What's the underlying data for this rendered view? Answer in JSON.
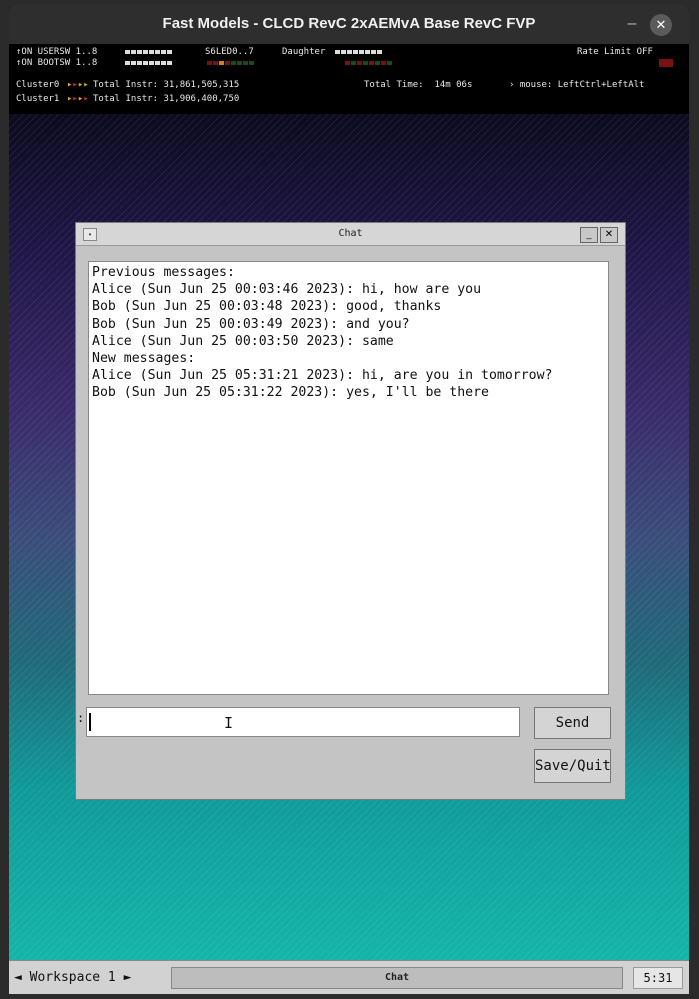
{
  "window": {
    "title": "Fast Models - CLCD RevC 2xAEMvA Base RevC FVP"
  },
  "status": {
    "usersw_label": "↑ON USERSW 1..8",
    "bootsw_label": "↑ON BOOTSW 1..8",
    "s6led_label": "S6LED0..7",
    "daughter_label": "Daughter",
    "rate_limit": "Rate Limit OFF",
    "cluster0_label": "Cluster0",
    "cluster0_instr": "Total Instr: 31,861,505,315",
    "cluster1_label": "Cluster1",
    "cluster1_instr": "Total Instr: 31,906,400,750",
    "total_time": "Total Time:  14m 06s",
    "mouse_hint": "› mouse: LeftCtrl+LeftAlt"
  },
  "chat": {
    "title": "Chat",
    "messages": [
      "Previous messages:",
      "Alice (Sun Jun 25 00:03:46 2023): hi, how are you",
      "Bob (Sun Jun 25 00:03:48 2023): good, thanks",
      "Bob (Sun Jun 25 00:03:49 2023): and you?",
      "Alice (Sun Jun 25 00:03:50 2023): same",
      "New messages:",
      "Alice (Sun Jun 25 05:31:21 2023): hi, are you in tomorrow?",
      "Bob (Sun Jun 25 05:31:22 2023): yes, I'll be there"
    ],
    "input_prefix": ":",
    "input_value": "",
    "send_label": "Send",
    "savequit_label": "Save/Quit"
  },
  "taskbar": {
    "workspace_label": "◄ Workspace 1 ►",
    "task_label": "Chat",
    "clock": "5:31"
  }
}
